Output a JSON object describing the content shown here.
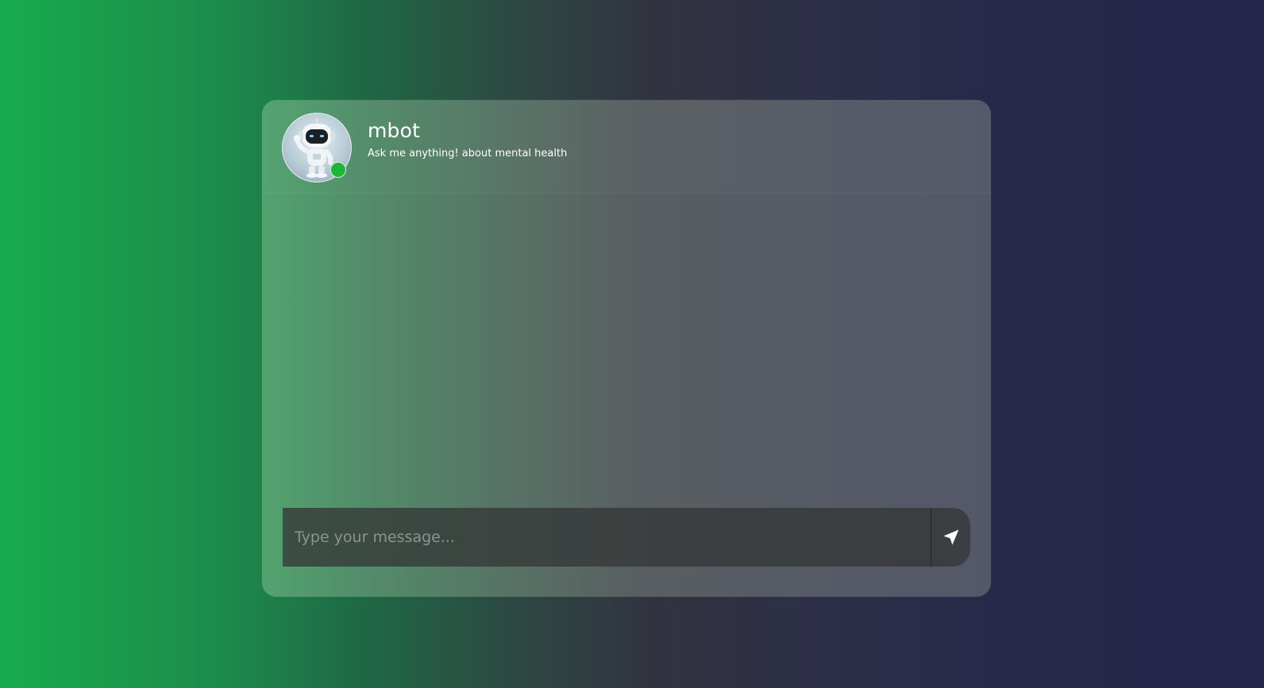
{
  "bot": {
    "name": "mbot",
    "subtitle": "Ask me anything! about mental health",
    "status": "online",
    "status_color": "#1db535",
    "avatar_icon": "robot-avatar-icon"
  },
  "composer": {
    "placeholder": "Type your message...",
    "value": "",
    "send_icon": "send-arrow-icon"
  },
  "messages": []
}
